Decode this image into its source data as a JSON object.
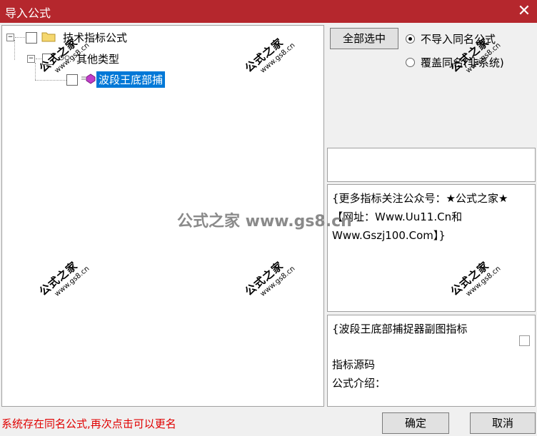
{
  "window": {
    "title": "导入公式",
    "close_glyph": "✕"
  },
  "tree": {
    "root_label": "技术指标公式",
    "child_label": "其他类型",
    "leaf_label": "波段王底部捕"
  },
  "buttons": {
    "select_all": "全部选中",
    "ok": "确定",
    "cancel": "取消"
  },
  "options": {
    "opt1": "不导入同名公式",
    "opt2": "覆盖同名(非系统)",
    "selected": "opt1"
  },
  "info_text": "{更多指标关注公众号：★公式之家★ 【网址：Www.Uu11.Cn和Www.Gszj100.Com】}",
  "detail": {
    "title": "{波段王底部捕捉器副图指标",
    "source_label": "指标源码",
    "intro_label": "公式介绍："
  },
  "status_message": "系统存在同名公式,再次点击可以更名",
  "watermark": {
    "brand": "公式之家",
    "url": "www.gs8.cn",
    "center": "公式之家 www.gs8.cn"
  },
  "colors": {
    "titlebar": "#b5272d",
    "selection": "#0078d7",
    "status": "#e00000"
  }
}
